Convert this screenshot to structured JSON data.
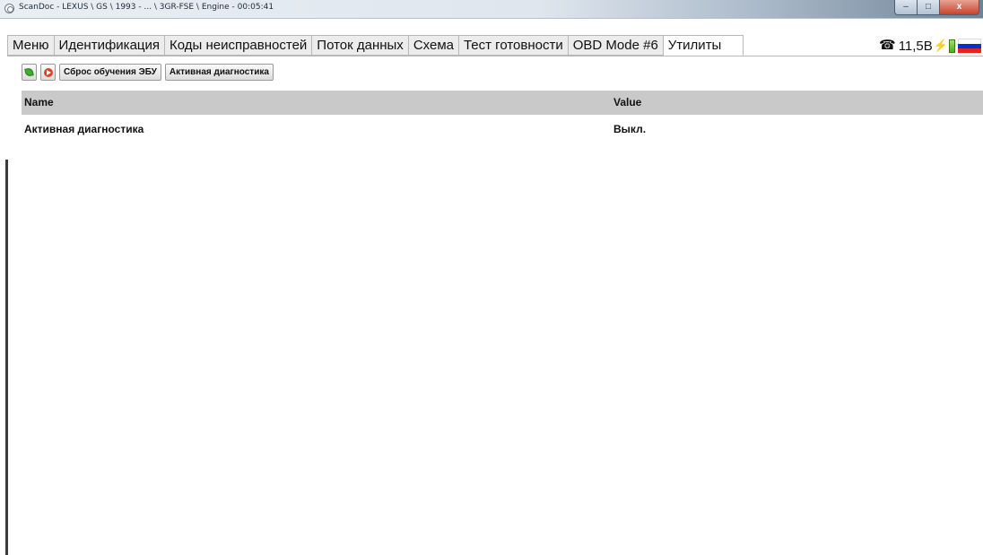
{
  "window": {
    "title": "ScanDoc - LEXUS \\ GS \\ 1993 - ... \\ 3GR-FSE \\ Engine - 00:05:41",
    "minimize": "–",
    "maximize": "□",
    "close": "x"
  },
  "tabs": [
    {
      "label": "Меню"
    },
    {
      "label": "Идентификация"
    },
    {
      "label": "Коды неисправностей"
    },
    {
      "label": "Поток данных"
    },
    {
      "label": "Схема"
    },
    {
      "label": "Тест готовности"
    },
    {
      "label": "OBD Mode #6"
    },
    {
      "label": "Утилиты",
      "active": true
    }
  ],
  "status": {
    "phone_icon": "☎",
    "voltage": "11,5В",
    "plug_icon": "power-plug-icon",
    "battery_icon": "battery-icon",
    "flag_icon": "russian-flag-icon",
    "flag_colors": [
      "#ffffff",
      "#0033cc",
      "#e8211b"
    ]
  },
  "toolbar": {
    "reset_label": "Сброс обучения ЭБУ",
    "active_diag_label": "Активная диагностика"
  },
  "table": {
    "headers": {
      "name": "Name",
      "value": "Value"
    },
    "rows": [
      {
        "name": "Активная диагностика",
        "value": "Выкл."
      }
    ]
  }
}
